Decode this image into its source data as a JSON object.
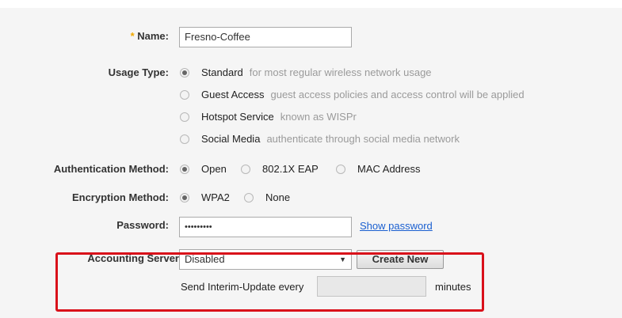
{
  "name_field": {
    "required_mark": "*",
    "label": "Name:",
    "value": "Fresno-Coffee"
  },
  "usage_type": {
    "label": "Usage Type:",
    "selected": "Standard",
    "options": [
      {
        "label": "Standard",
        "desc": "for most regular wireless network usage"
      },
      {
        "label": "Guest Access",
        "desc": "guest access policies and access control will be applied"
      },
      {
        "label": "Hotspot Service",
        "desc": "known as WISPr"
      },
      {
        "label": "Social Media",
        "desc": "authenticate through social media network"
      }
    ]
  },
  "auth_method": {
    "label": "Authentication Method:",
    "selected": "Open",
    "options": [
      "Open",
      "802.1X EAP",
      "MAC Address"
    ]
  },
  "encryption_method": {
    "label": "Encryption Method:",
    "selected": "WPA2",
    "options": [
      "WPA2",
      "None"
    ]
  },
  "password": {
    "label": "Password:",
    "value": "•••••••••",
    "show_link": "Show password"
  },
  "accounting": {
    "label": "Accounting Server",
    "selected": "Disabled",
    "create_button": "Create New",
    "interim_prefix": "Send Interim-Update every",
    "interim_value": "",
    "interim_suffix": "minutes"
  },
  "colors": {
    "highlight": "#d9101a",
    "link": "#1a5fd0",
    "required": "#f0a800"
  }
}
